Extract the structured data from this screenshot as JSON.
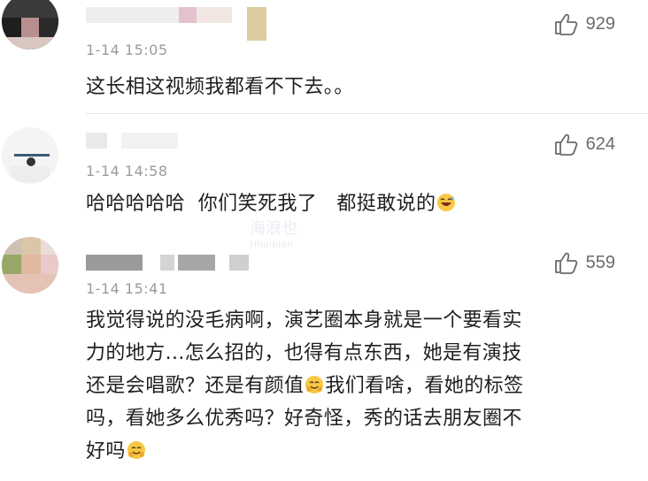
{
  "comments": [
    {
      "time": "1-14 15:05",
      "text": "这长相这视频我都看不下去。。",
      "likes": "929"
    },
    {
      "time": "1-14 14:58",
      "text_parts": [
        "哈哈哈哈哈  你们笑死我了   都挺敢说的"
      ],
      "emoji": "grinning-sweat-emoji",
      "likes": "624"
    },
    {
      "time": "1-14 15:41",
      "lines": [
        "我觉得说的没毛病啊，演艺圈本身就是一个要看实",
        "力的地方...怎么招的，也得有点东西，她是有演技",
        "还是会唱歌？还是有颜值",
        "我们看啥，看她的标签",
        "吗，看她多么优秀吗？好奇怪，秀的话去朋友圈不",
        "好吗"
      ],
      "emoji": "hugging-face-emoji",
      "likes": "559"
    }
  ],
  "watermark": {
    "main": "海浪也",
    "sub": "Hhaibian"
  },
  "icons": {
    "like": "thumbs-up-icon"
  },
  "colors": {
    "text": "#1e1e1e",
    "meta": "#9a9a9a",
    "like": "#6b6b6b"
  }
}
